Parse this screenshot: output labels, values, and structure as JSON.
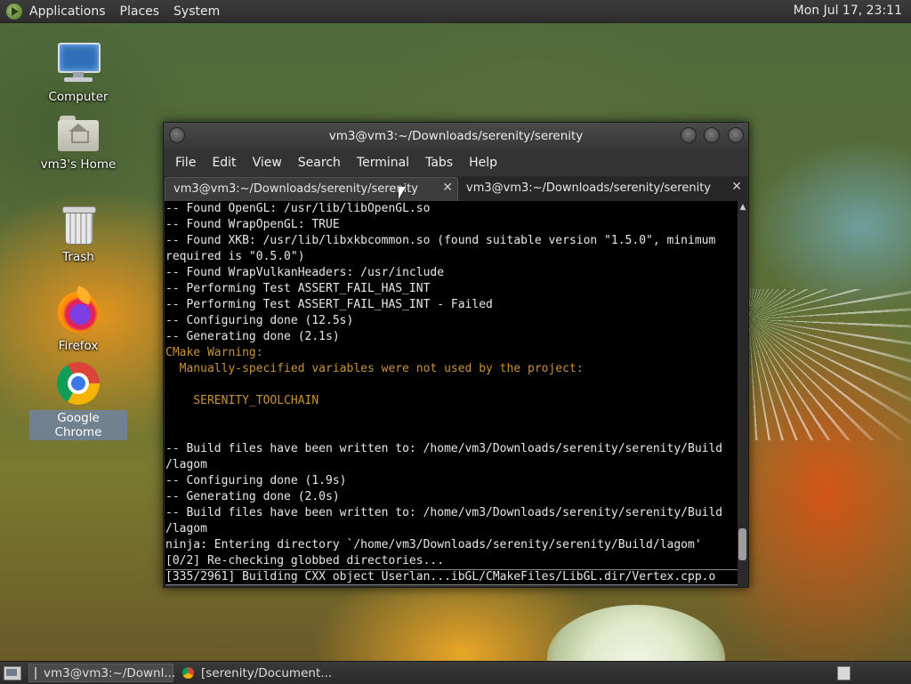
{
  "top_panel": {
    "menus": [
      "Applications",
      "Places",
      "System"
    ],
    "clock": "Mon Jul 17, 23:11"
  },
  "desktop_icons": [
    {
      "label": "Computer",
      "icon": "computer-icon"
    },
    {
      "label": "vm3's Home",
      "icon": "home-folder-icon"
    },
    {
      "label": "Trash",
      "icon": "trash-icon"
    },
    {
      "label": "Firefox",
      "icon": "firefox-icon"
    },
    {
      "label": "Google Chrome",
      "icon": "chrome-icon",
      "selected": true
    }
  ],
  "terminal_window": {
    "title": "vm3@vm3:~/Downloads/serenity/serenity",
    "menu": [
      "File",
      "Edit",
      "View",
      "Search",
      "Terminal",
      "Tabs",
      "Help"
    ],
    "tabs": [
      {
        "label": "vm3@vm3:~/Downloads/serenity/serenity",
        "active": true
      },
      {
        "label": "vm3@vm3:~/Downloads/serenity/serenity",
        "active": false
      }
    ],
    "lines": [
      {
        "text": "-- Found OpenGL: /usr/lib/libOpenGL.so"
      },
      {
        "text": "-- Found WrapOpenGL: TRUE"
      },
      {
        "text": "-- Found XKB: /usr/lib/libxkbcommon.so (found suitable version \"1.5.0\", minimum"
      },
      {
        "text": "required is \"0.5.0\")"
      },
      {
        "text": "-- Found WrapVulkanHeaders: /usr/include"
      },
      {
        "text": "-- Performing Test ASSERT_FAIL_HAS_INT"
      },
      {
        "text": "-- Performing Test ASSERT_FAIL_HAS_INT - Failed"
      },
      {
        "text": "-- Configuring done (12.5s)"
      },
      {
        "text": "-- Generating done (2.1s)"
      },
      {
        "text": "CMake Warning:",
        "style": "warn"
      },
      {
        "text": "  Manually-specified variables were not used by the project:",
        "style": "warn"
      },
      {
        "text": ""
      },
      {
        "text": "    SERENITY_TOOLCHAIN",
        "style": "warn"
      },
      {
        "text": ""
      },
      {
        "text": ""
      },
      {
        "text": "-- Build files have been written to: /home/vm3/Downloads/serenity/serenity/Build"
      },
      {
        "text": "/lagom"
      },
      {
        "text": "-- Configuring done (1.9s)"
      },
      {
        "text": "-- Generating done (2.0s)"
      },
      {
        "text": "-- Build files have been written to: /home/vm3/Downloads/serenity/serenity/Build"
      },
      {
        "text": "/lagom"
      },
      {
        "text": "ninja: Entering directory `/home/vm3/Downloads/serenity/serenity/Build/lagom'"
      },
      {
        "text": "[0/2] Re-checking globbed directories..."
      },
      {
        "text": "[335/2961] Building CXX object Userlan...ibGL/CMakeFiles/LibGL.dir/Vertex.cpp.o",
        "style": "last"
      }
    ],
    "colors": {
      "warning_text": "#c89236",
      "background": "#000000",
      "foreground": "#e8e8e8"
    }
  },
  "bottom_panel": {
    "tasks": [
      {
        "label": "vm3@vm3:~/Downl...",
        "icon": "terminal-icon",
        "active": true
      },
      {
        "label": "[serenity/Document...",
        "icon": "chrome-icon",
        "active": false
      }
    ]
  }
}
